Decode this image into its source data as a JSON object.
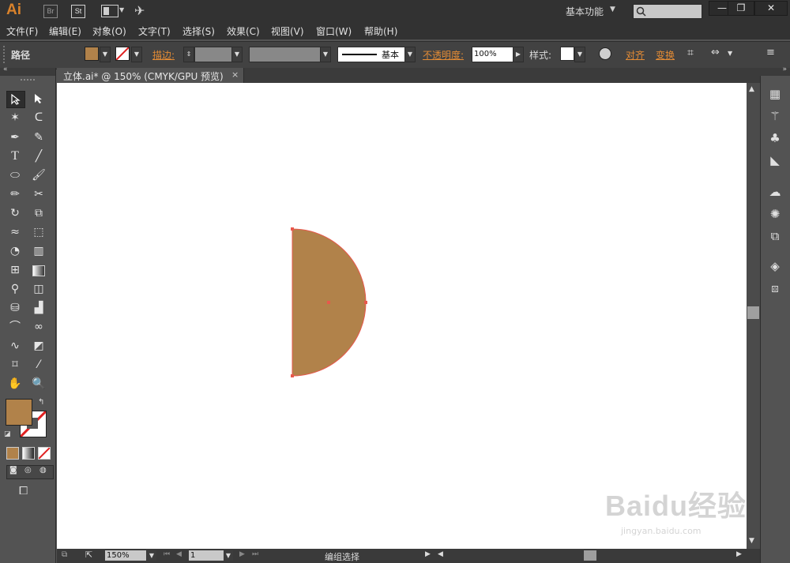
{
  "app": {
    "logo": "Ai",
    "badge_br": "Br",
    "badge_st": "St",
    "workspace": "基本功能",
    "search_placeholder": ""
  },
  "window_controls": {
    "minimize": "—",
    "restore": "❐",
    "close": "✕"
  },
  "menu": [
    "文件(F)",
    "编辑(E)",
    "对象(O)",
    "文字(T)",
    "选择(S)",
    "效果(C)",
    "视图(V)",
    "窗口(W)",
    "帮助(H)"
  ],
  "control_bar": {
    "selection_type": "路径",
    "stroke_label": "描边:",
    "stroke_style": "基本",
    "opacity_label": "不透明度:",
    "opacity_value": "100%",
    "style_label": "样式:",
    "align_link": "对齐",
    "transform_link": "变换"
  },
  "document_tab": {
    "title": "立体.ai* @ 150% (CMYK/GPU 预览)",
    "close": "×"
  },
  "status_bar": {
    "zoom": "150%",
    "page": "1",
    "status": "编组选择"
  },
  "colors": {
    "fill": "#b1824a",
    "anchor": "#e8584c",
    "accent": "#e38b35"
  },
  "watermark": {
    "brand": "Baidu经验",
    "url": "jingyan.baidu.com"
  },
  "icons": {
    "tools": [
      "selection-icon",
      "direct-selection-icon",
      "magic-wand-icon",
      "lasso-icon",
      "pen-icon",
      "curvature-icon",
      "type-icon",
      "line-icon",
      "ellipse-icon",
      "paintbrush-icon",
      "pencil-icon",
      "scissors-icon",
      "rotate-icon",
      "scale-icon",
      "width-icon",
      "free-transform-icon",
      "shape-builder-icon",
      "perspective-icon",
      "mesh-icon",
      "gradient-icon",
      "eyedropper-icon",
      "blend-icon",
      "symbol-sprayer-icon",
      "column-graph-icon",
      "artboard-icon",
      "slice-icon",
      "hand-icon",
      "zoom-icon"
    ]
  }
}
